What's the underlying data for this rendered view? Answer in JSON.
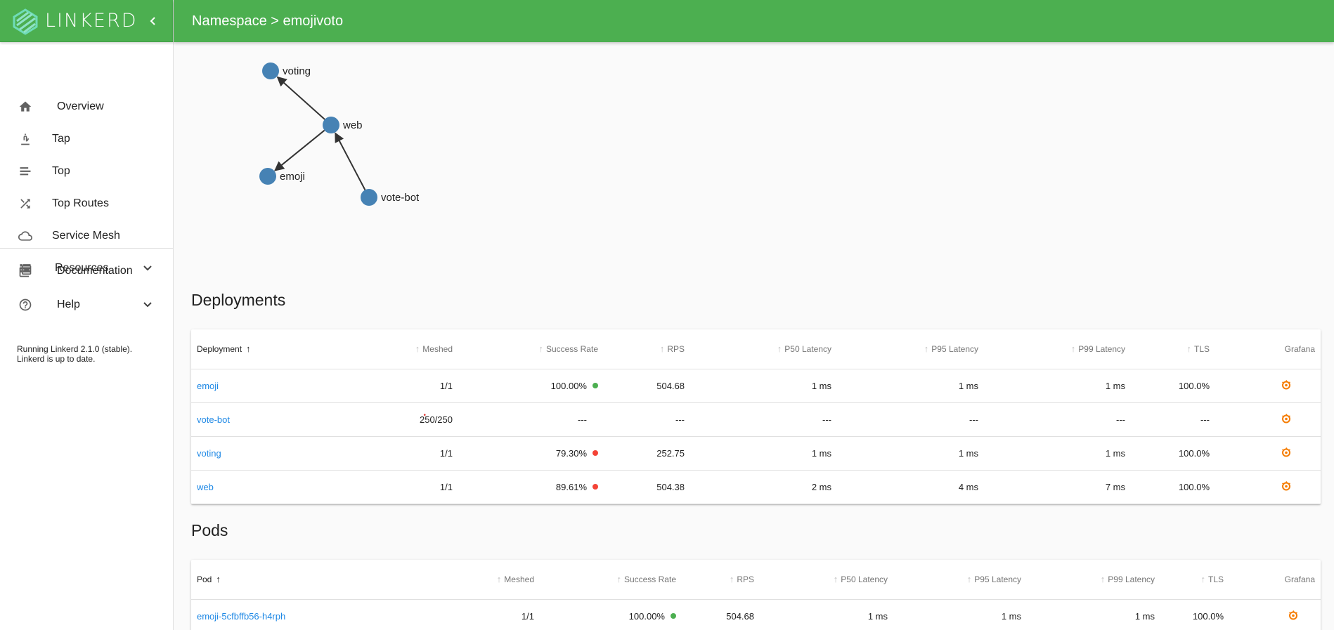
{
  "brand": {
    "name": "LINKERD"
  },
  "header": {
    "breadcrumb": "Namespace > emojivoto"
  },
  "colors": {
    "accent": "#4caf50",
    "link": "#1e88e5",
    "node": "#4682b4",
    "success": "#4caf50",
    "error": "#f44336"
  },
  "sidebar": {
    "items": [
      {
        "label": "Overview",
        "icon": "home-icon"
      },
      {
        "label": "Tap",
        "icon": "microscope-icon"
      },
      {
        "label": "Top",
        "icon": "list-icon"
      },
      {
        "label": "Top Routes",
        "icon": "shuffle-icon"
      },
      {
        "label": "Service Mesh",
        "icon": "cloud-icon"
      },
      {
        "label": "Resources",
        "icon": "list-view-icon"
      }
    ],
    "secondary": [
      {
        "label": "Documentation",
        "icon": "library-books-icon"
      },
      {
        "label": "Help",
        "icon": "help-circle-icon"
      }
    ],
    "version_line1": "Running Linkerd 2.1.0 (stable).",
    "version_line2": "Linkerd is up to date."
  },
  "graph": {
    "nodes": [
      {
        "id": "voting",
        "label": "voting"
      },
      {
        "id": "web",
        "label": "web"
      },
      {
        "id": "emoji",
        "label": "emoji"
      },
      {
        "id": "vote-bot",
        "label": "vote-bot"
      }
    ],
    "edges": [
      {
        "from": "web",
        "to": "voting"
      },
      {
        "from": "web",
        "to": "emoji"
      },
      {
        "from": "vote-bot",
        "to": "web"
      }
    ]
  },
  "deployments": {
    "title": "Deployments",
    "headers": [
      "Deployment",
      "Meshed",
      "Success Rate",
      "RPS",
      "P50 Latency",
      "P95 Latency",
      "P99 Latency",
      "TLS",
      "Grafana"
    ],
    "rows": [
      {
        "name": "emoji",
        "meshed": "1/1",
        "success": "100.00%",
        "status": "success",
        "rps": "504.68",
        "p50": "1 ms",
        "p95": "1 ms",
        "p99": "1 ms",
        "tls": "100.0%"
      },
      {
        "name": "vote-bot",
        "meshed": "250/250",
        "success": "---",
        "status": "none",
        "rps": "---",
        "p50": "---",
        "p95": "---",
        "p99": "---",
        "tls": "---"
      },
      {
        "name": "voting",
        "meshed": "1/1",
        "success": "79.30%",
        "status": "error",
        "rps": "252.75",
        "p50": "1 ms",
        "p95": "1 ms",
        "p99": "1 ms",
        "tls": "100.0%"
      },
      {
        "name": "web",
        "meshed": "1/1",
        "success": "89.61%",
        "status": "error",
        "rps": "504.38",
        "p50": "2 ms",
        "p95": "4 ms",
        "p99": "7 ms",
        "tls": "100.0%"
      }
    ]
  },
  "pods": {
    "title": "Pods",
    "headers": [
      "Pod",
      "Meshed",
      "Success Rate",
      "RPS",
      "P50 Latency",
      "P95 Latency",
      "P99 Latency",
      "TLS",
      "Grafana"
    ],
    "rows": [
      {
        "name": "emoji-5cfbffb56-h4rph",
        "meshed": "1/1",
        "success": "100.00%",
        "status": "success",
        "rps": "504.68",
        "p50": "1 ms",
        "p95": "1 ms",
        "p99": "1 ms",
        "tls": "100.0%"
      }
    ]
  }
}
